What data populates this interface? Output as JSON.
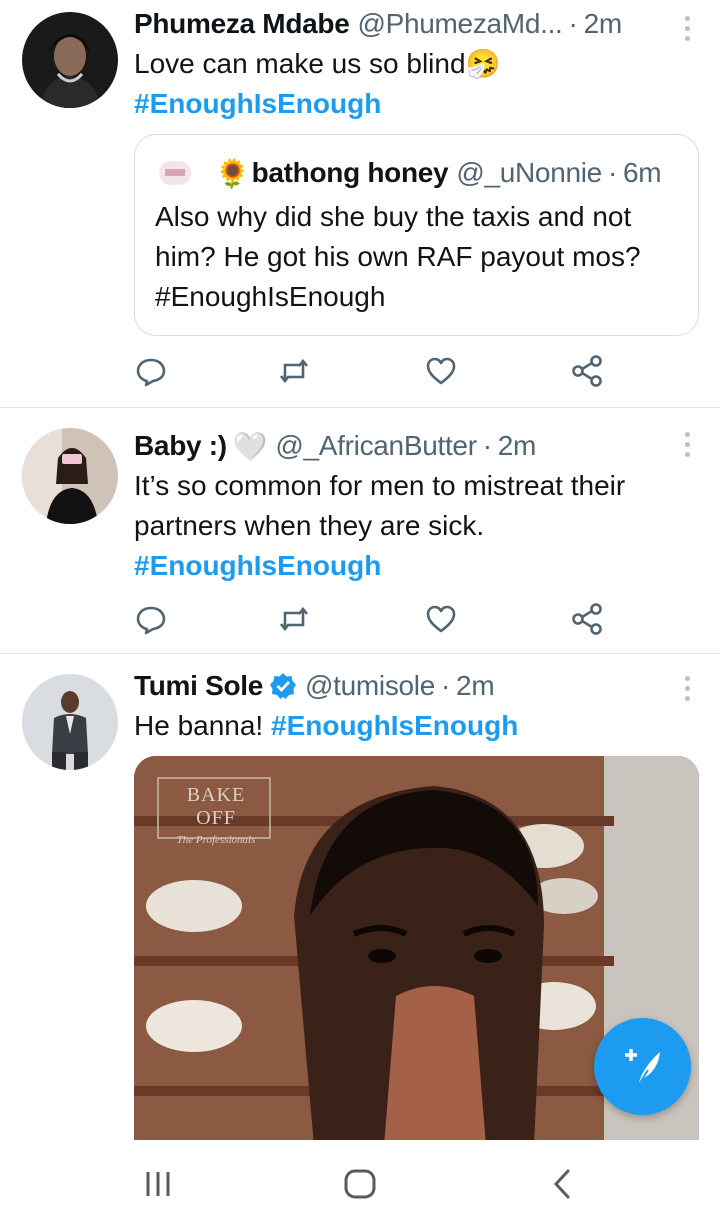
{
  "colors": {
    "accent": "#1d9bf0",
    "secondary_text": "#536471",
    "primary_text": "#0f1419",
    "divider": "#e3e6e8"
  },
  "tweets": [
    {
      "author_name": "Phumeza Mdabe",
      "author_handle": "@PhumezaMd...",
      "separator": "·",
      "time": "2m",
      "text": "Love can make us so blind",
      "text_emoji": "🤧",
      "hashtag": "#EnoughIsEnough",
      "quote": {
        "author_emoji": "🌻",
        "author_name": "bathong honey",
        "author_handle": "@_uNonnie",
        "separator": "·",
        "time": "6m",
        "text": "Also why did she buy the taxis and not him? He got his own RAF payout mos? #EnoughIsEnough"
      }
    },
    {
      "author_name": "Baby :)",
      "author_name_emoji": "🤍",
      "author_handle": "@_AfricanButter",
      "separator": "·",
      "time": "2m",
      "text": "It’s so common for men to mistreat their partners when they are sick.",
      "hashtag": "#EnoughIsEnough"
    },
    {
      "author_name": "Tumi Sole",
      "verified": true,
      "author_handle": "@tumisole",
      "separator": "·",
      "time": "2m",
      "text": "He banna!",
      "hashtag": "#EnoughIsEnough",
      "media": {
        "watermark_title": "BAKE OFF",
        "watermark_subtitle": "The Professionals"
      }
    }
  ],
  "icons": {
    "reply": "speech-bubble-icon",
    "retweet": "retweet-icon",
    "like": "heart-icon",
    "share": "share-icon",
    "compose": "feather-plus-icon",
    "nav_recents": "recents-icon",
    "nav_home": "home-icon",
    "nav_back": "back-icon"
  }
}
